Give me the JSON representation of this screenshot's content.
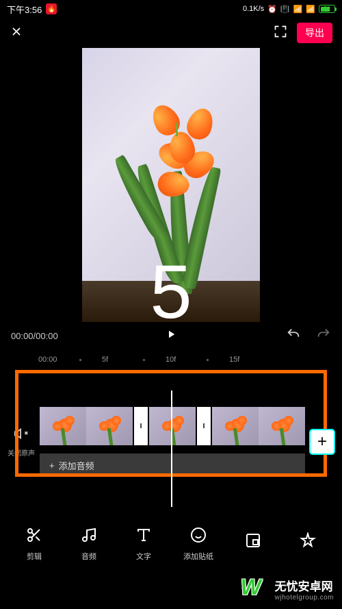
{
  "status": {
    "time": "下午3:56",
    "network": "0.1K/s",
    "battery": "72"
  },
  "topbar": {
    "export": "导出"
  },
  "preview": {
    "countdown": "5"
  },
  "playback": {
    "current": "00:00",
    "total": "00:00"
  },
  "ruler": {
    "marks": [
      "00:00",
      "5f",
      "10f",
      "15f"
    ]
  },
  "timeline": {
    "mute_label": "关闭原声",
    "add_audio": "添加音频"
  },
  "tools": [
    {
      "label": "剪辑"
    },
    {
      "label": "音频"
    },
    {
      "label": "文字"
    },
    {
      "label": "添加贴纸"
    },
    {
      "label": ""
    },
    {
      "label": ""
    }
  ],
  "watermark": {
    "title": "无忧安卓网",
    "sub": "wjhotelgroup.com"
  }
}
